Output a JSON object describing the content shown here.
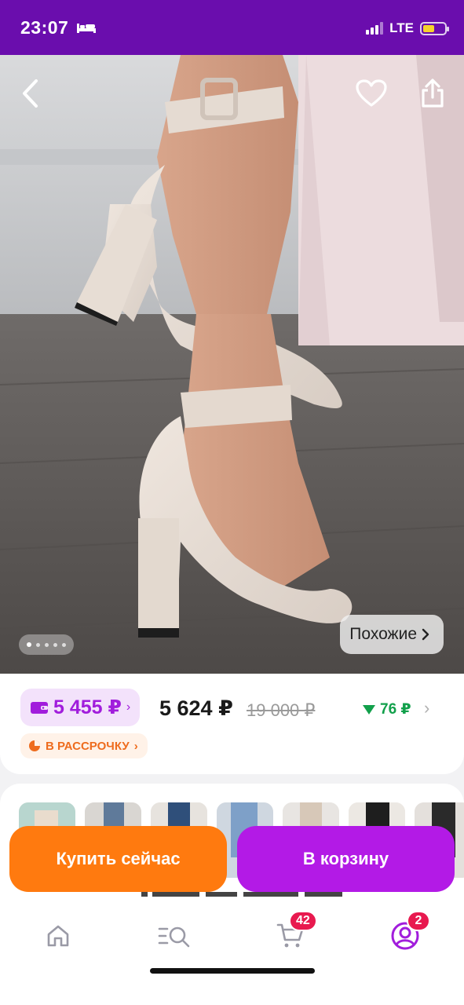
{
  "status_bar": {
    "time": "23:07",
    "network": "LTE",
    "battery_level": 0.55,
    "colors": {
      "background": "#6a0dad",
      "battery": "#f6d32b"
    }
  },
  "hero": {
    "icons": {
      "back": "chevron-left-icon",
      "favorite": "heart-icon",
      "share": "share-icon"
    },
    "gallery_dots": 5,
    "gallery_active_index": 0,
    "similar_label": "Похожие"
  },
  "price": {
    "wallet_price": "5 455 ₽",
    "current_price": "5 624 ₽",
    "old_price": "19 000 ₽",
    "delta": "76 ₽",
    "installment_label": "В РАССРОЧКУ",
    "colors": {
      "wallet": "#a11ddc",
      "delta": "#12a04b",
      "installment": "#ee6c1e"
    }
  },
  "variants": {
    "count_visible": 7
  },
  "actions": {
    "buy_now": "Купить сейчас",
    "add_to_cart": "В корзину",
    "colors": {
      "buy_now": "#ff7a0f",
      "add_to_cart": "#b31ae6"
    }
  },
  "tab_bar": {
    "tabs": [
      {
        "icon": "home-icon"
      },
      {
        "icon": "catalog-search-icon"
      },
      {
        "icon": "cart-icon",
        "badge": "42"
      },
      {
        "icon": "profile-icon",
        "badge": "2"
      }
    ]
  }
}
